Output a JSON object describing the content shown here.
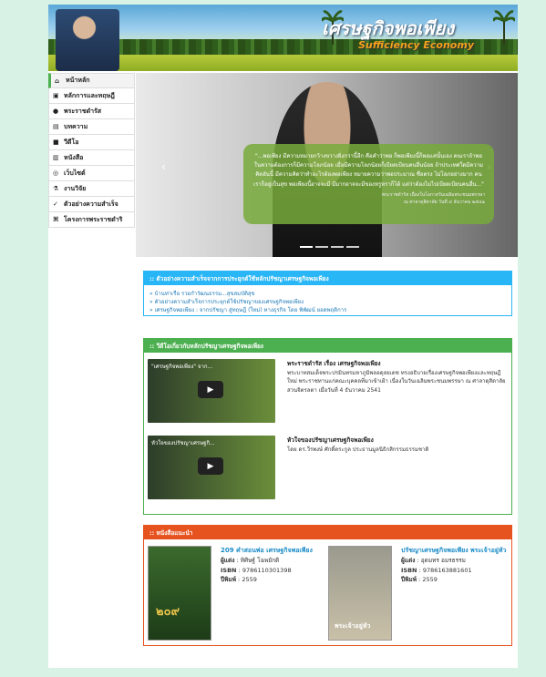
{
  "banner": {
    "title": "เศรษฐกิจพอเพียง",
    "subtitle": "Sufficiency Economy"
  },
  "nav": [
    {
      "label": "หน้าหลัก",
      "icon": "home-icon",
      "glyph": "⌂"
    },
    {
      "label": "หลักการและทฤษฎี",
      "icon": "book-icon",
      "glyph": "▣"
    },
    {
      "label": "พระราชดำรัส",
      "icon": "comment-icon",
      "glyph": "●"
    },
    {
      "label": "บทความ",
      "icon": "document-icon",
      "glyph": "▤"
    },
    {
      "label": "วีดีโอ",
      "icon": "video-icon",
      "glyph": "■"
    },
    {
      "label": "หนังสือ",
      "icon": "book-icon",
      "glyph": "▥"
    },
    {
      "label": "เว็บไซต์",
      "icon": "globe-icon",
      "glyph": "◎"
    },
    {
      "label": "งานวิจัย",
      "icon": "flask-icon",
      "glyph": "⚗"
    },
    {
      "label": "ตัวอย่างความสำเร็จ",
      "icon": "thumbs-up-icon",
      "glyph": "✓"
    },
    {
      "label": "โครงการพระราชดำริ",
      "icon": "sitemap-icon",
      "glyph": "⌘"
    }
  ],
  "slider": {
    "quote": "\"...พอเพียง มีความหมายกว้างขวางยิ่งกว่านี้อีก คือคำว่าพอ ก็พอเพียงนี้ก็พอแค่นั้นเอง คนเราถ้าพอในความต้องการก็มีความโลภน้อย เมื่อมีความโลภน้อยก็เบียดเบียนคนอื่นน้อย ถ้าประเทศใดมีความคิดอันนี้ มีความคิดว่าทำอะไรต้องพอเพียง หมายความว่าพอประมาณ ซื่อตรง ไม่โลภอย่างมาก คนเราก็อยู่เป็นสุข พอเพียงนี้อาจจะมี มีมากอาจจะมีของหรูหราก็ได้ แต่ว่าต้องไม่ไปเบียดเบียนคนอื่น...\"",
    "cite1": "พระราชดำรัส เนื่องในโอกาสวันเฉลิมพระชนมพรรษา",
    "cite2": "ณ ศาลาดุสิดาลัย วันที่ ๔ ธันวาคม ๒๕๔๑"
  },
  "success": {
    "heading": ":: ตัวอย่างความสำเร็จจากการประยุกต์ใช้หลักปรัชญาเศรษฐกิจพอเพียง",
    "links": [
      "» บ้านท่าเรือ รวยกำวัฒนธรรม...สุขสมบัติสุข",
      "» ตัวอย่างความสำเร็จการประยุกต์ใช้ปรัชญาของเศรษฐกิจพอเพียง",
      "» เศรษฐกิจพอเพียง : จากปรัชญา สู่ทฤษฎี (ใหม่) ทางธุรกิจ โดย พิพัฒน์ ยอดพฤติการ"
    ]
  },
  "videos": {
    "heading": ":: วีดีโอเกี่ยวกับหลักปรัชญาเศรษฐกิจพอเพียง",
    "items": [
      {
        "thumb_title": "\"เศรษฐกิจพอเพียง\" จาก...",
        "title": "พระราชดำรัส เรื่อง เศรษฐกิจพอเพียง",
        "desc": "พระบาทสมเด็จพระปรมินทรมหาภูมิพลอดุลยเดช ทรงอธิบายเรื่องเศรษฐกิจพอเพียงและทฤษฎีใหม่ พระราชทานแก่คณะบุคคลที่มาเข้าเฝ้า เนื่องในวันเฉลิมพระชนมพรรษา ณ ศาลาดุสิดาลัย สวนจิตรลดา เมื่อวันที่ 4 ธันวาคม 2541"
      },
      {
        "thumb_title": "หัวใจของปรัชญาเศรษฐกิ...",
        "title": "หัวใจของปรัชญาเศรษฐกิจพอเพียง",
        "desc": "โดย ดร.วีรพงษ์ ศักดิ์ตระกูล ประธานมูลนิธิกสิกรรมธรรมชาติ"
      }
    ]
  },
  "books": {
    "heading": ":: หนังสือแนะนำ",
    "items": [
      {
        "title": "209 คำสอนพ่อ เศรษฐกิจพอเพียง",
        "author_label": "ผู้แต่ง",
        "author": "ทิศิษฐ์ โฉพยักติ",
        "isbn_label": "ISBN",
        "isbn": "9786110301398",
        "year_label": "ปีพิมพ์",
        "year": "2559",
        "cover_text": "๒๐๙"
      },
      {
        "title": "ปรัชญาเศรษฐกิจพอเพียง พระเจ้าอยู่หัว",
        "author_label": "ผู้แต่ง",
        "author": "อุดมทร อมรธรรม",
        "isbn_label": "ISBN",
        "isbn": "9786163881601",
        "year_label": "ปีพิมพ์",
        "year": "2559",
        "cover_text": "พระเจ้าอยู่หัว"
      }
    ]
  }
}
